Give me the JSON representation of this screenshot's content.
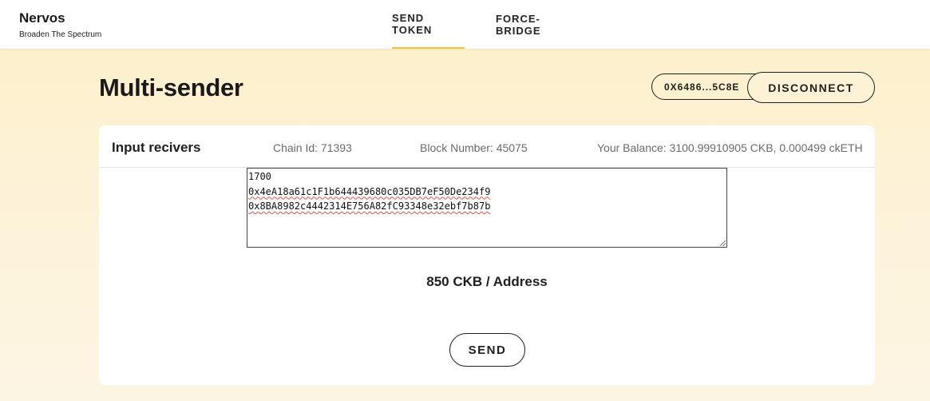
{
  "brand": {
    "name": "Nervos",
    "tagline": "Broaden The Spectrum"
  },
  "nav": {
    "tabs": [
      {
        "label": "SEND TOKEN",
        "active": true
      },
      {
        "label": "FORCE-BRIDGE",
        "active": false
      }
    ]
  },
  "page": {
    "title": "Multi-sender"
  },
  "wallet": {
    "address_short": "0X6486...5C8E",
    "disconnect_label": "DISCONNECT"
  },
  "card": {
    "title": "Input recivers",
    "chain_id": "Chain Id: 71393",
    "block_number": "Block Number: 45075",
    "balance": "Your Balance: 3100.99910905 CKB, 0.000499 ckETH"
  },
  "receivers": {
    "lines": [
      "1700",
      "0x4eA18a61c1F1b644439680c035DB7eF50De234f9",
      "0x8BA8982c4442314E756A82fC93348e32ebf7b87b"
    ]
  },
  "summary": {
    "per_address": "850 CKB / Address"
  },
  "actions": {
    "send_label": "SEND"
  },
  "colors": {
    "accent": "#f0c534",
    "background": "#fdf2d6",
    "text": "#1f1f1f",
    "muted": "#6b6b6b"
  }
}
